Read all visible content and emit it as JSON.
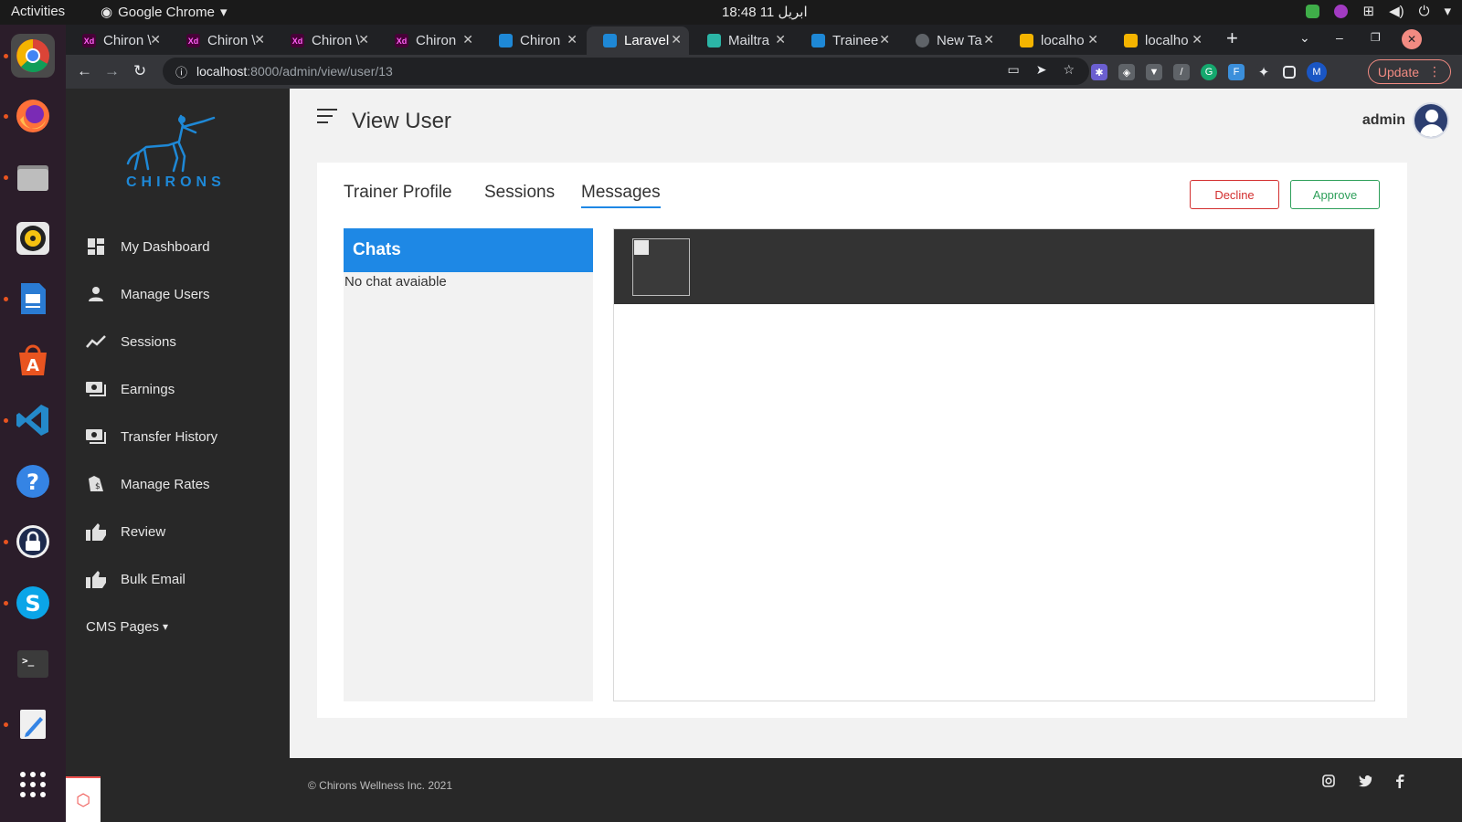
{
  "topbar": {
    "activities": "Activities",
    "app_menu": "Google Chrome",
    "clock": "18:48  11 ابریل"
  },
  "dock": {
    "apps": [
      "chrome-icon",
      "firefox-icon",
      "files-icon",
      "rhythmbox-icon",
      "libreoffice-impress-icon",
      "software-center-icon",
      "vscode-icon",
      "help-icon",
      "keepass-icon",
      "skype-icon",
      "terminal-icon",
      "text-editor-icon",
      "show-apps-icon"
    ]
  },
  "browser": {
    "tabs": [
      {
        "title": "Chiron \\",
        "fav": "Xd"
      },
      {
        "title": "Chiron \\",
        "fav": "Xd"
      },
      {
        "title": "Chiron \\",
        "fav": "Xd"
      },
      {
        "title": "Chiron",
        "fav": "Xd"
      },
      {
        "title": "Chiron",
        "fav": ""
      },
      {
        "title": "Laravel",
        "fav": ""
      },
      {
        "title": "Mailtra",
        "fav": ""
      },
      {
        "title": "Trainee",
        "fav": ""
      },
      {
        "title": "New Ta",
        "fav": ""
      },
      {
        "title": "localho",
        "fav": ""
      },
      {
        "title": "localho",
        "fav": ""
      }
    ],
    "url_host": "localhost",
    "url_path": ":8000/admin/view/user/13",
    "update_label": "Update",
    "profile_initial": "M"
  },
  "sidebar": {
    "brand": "CHIRONS",
    "items": [
      {
        "label": "My Dashboard",
        "icon": "dashboard-icon"
      },
      {
        "label": "Manage Users",
        "icon": "user-icon"
      },
      {
        "label": "Sessions",
        "icon": "trend-line-icon"
      },
      {
        "label": "Earnings",
        "icon": "money-icon"
      },
      {
        "label": "Transfer History",
        "icon": "money-icon"
      },
      {
        "label": "Manage Rates",
        "icon": "price-tag-icon"
      },
      {
        "label": "Review",
        "icon": "thumbs-up-icon"
      },
      {
        "label": "Bulk Email",
        "icon": "thumbs-up-icon"
      }
    ],
    "cms_label": "CMS Pages"
  },
  "header": {
    "title": "View User",
    "user": "admin"
  },
  "card": {
    "tabs": [
      "Trainer Profile",
      "Sessions",
      "Messages"
    ],
    "active_tab": "Messages",
    "decline_label": "Decline",
    "approve_label": "Approve"
  },
  "chats": {
    "heading": "Chats",
    "empty": "No chat avaiable"
  },
  "footer": {
    "copyright": "© Chirons Wellness Inc. 2021",
    "social": [
      "instagram-icon",
      "twitter-icon",
      "facebook-icon"
    ]
  },
  "colors": {
    "accent": "#1e88e5",
    "decline": "#d32f2f",
    "approve": "#2e9f5a",
    "sidebar": "#282828"
  }
}
